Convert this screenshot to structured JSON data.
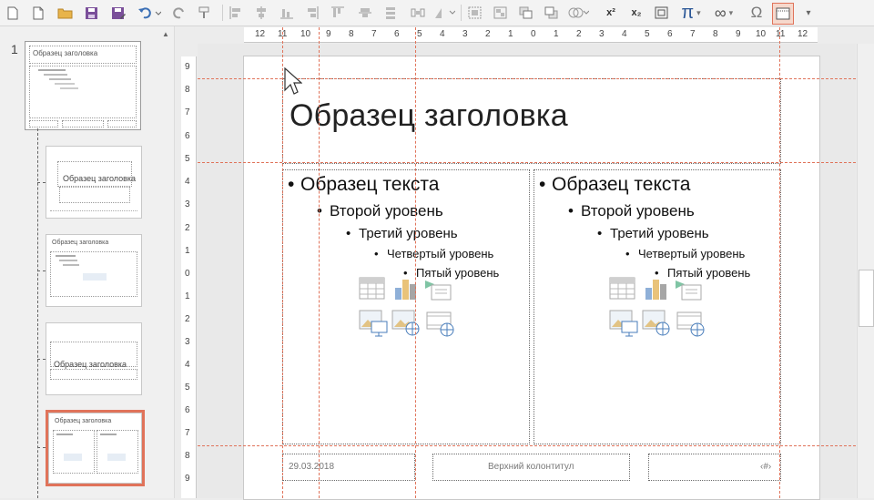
{
  "toolbar": {
    "items": [
      "new-doc",
      "new-doc-2",
      "open-folder",
      "save",
      "save-as",
      "undo",
      "redo",
      "format-painter",
      "align-1",
      "align-2",
      "align-3",
      "align-4",
      "align-5",
      "align-6",
      "align-7",
      "group",
      "ungroup",
      "bring-front",
      "send-back",
      "merge-shapes",
      "superscript",
      "subscript",
      "text-box",
      "equation",
      "infinity",
      "symbol",
      "header-footer",
      "more"
    ],
    "superscript_label": "x²",
    "subscript_label": "x₂",
    "pi_label": "π",
    "infinity_label": "∞",
    "omega_label": "Ω"
  },
  "ruler": {
    "h_labels": [
      "12",
      "11",
      "10",
      "9",
      "8",
      "7",
      "6",
      "5",
      "4",
      "3",
      "2",
      "1",
      "0",
      "1",
      "2",
      "3",
      "4",
      "5",
      "6",
      "7",
      "8",
      "9",
      "10",
      "11",
      "12"
    ],
    "v_labels": [
      "9",
      "8",
      "7",
      "6",
      "5",
      "4",
      "3",
      "2",
      "1",
      "0",
      "1",
      "2",
      "3",
      "4",
      "5",
      "6",
      "7",
      "8",
      "9"
    ]
  },
  "thumbpane": {
    "slide_number": "1",
    "master_title": "Образец заголовка",
    "thumb_titles": [
      "Образец заголовка",
      "Образец заголовка",
      "Образец заголовка",
      "Образец заголовка"
    ]
  },
  "slide": {
    "title": "Образец заголовка",
    "left_column": {
      "level1": "Образец текста",
      "level2": "Второй уровень",
      "level3": "Третий уровень",
      "level4": "Четвертый уровень",
      "level5": "Пятый уровень"
    },
    "right_column": {
      "level1": "Образец текста",
      "level2": "Второй уровень",
      "level3": "Третий уровень",
      "level4": "Четвертый уровень",
      "level5": "Пятый уровень"
    },
    "footer": {
      "date": "29.03.2018",
      "center": "Верхний колонтитул",
      "number": "‹#›"
    }
  },
  "colors": {
    "accent_selection": "#e0735a",
    "guide": "#e0735a"
  }
}
